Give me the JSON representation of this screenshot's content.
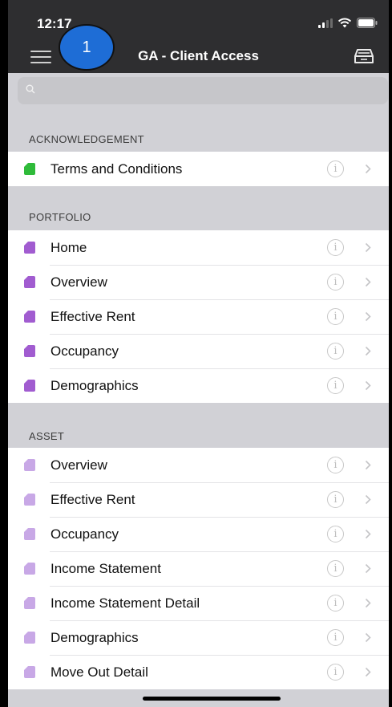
{
  "status_bar": {
    "time": "12:17"
  },
  "nav": {
    "title": "GA - Client Access",
    "annotation_badge": "1"
  },
  "search": {
    "placeholder": ""
  },
  "sections": [
    {
      "header": "ACKNOWLEDGEMENT",
      "icon_color": "#2fbb3a",
      "items": [
        {
          "label": "Terms and Conditions"
        }
      ]
    },
    {
      "header": "PORTFOLIO",
      "icon_color": "#a15cd0",
      "items": [
        {
          "label": "Home"
        },
        {
          "label": "Overview"
        },
        {
          "label": "Effective Rent"
        },
        {
          "label": "Occupancy"
        },
        {
          "label": "Demographics"
        }
      ]
    },
    {
      "header": "ASSET",
      "icon_color": "#c8a8e6",
      "items": [
        {
          "label": "Overview"
        },
        {
          "label": "Effective Rent"
        },
        {
          "label": "Occupancy"
        },
        {
          "label": "Income Statement"
        },
        {
          "label": "Income Statement Detail"
        },
        {
          "label": "Demographics"
        },
        {
          "label": "Move Out Detail"
        }
      ]
    }
  ],
  "icons": {
    "menu": "hamburger-menu-icon",
    "inbox": "inbox-tray-icon",
    "search": "magnifier-icon",
    "info": "info-icon",
    "disclosure": "chevron-right-icon",
    "document": "document-icon"
  }
}
